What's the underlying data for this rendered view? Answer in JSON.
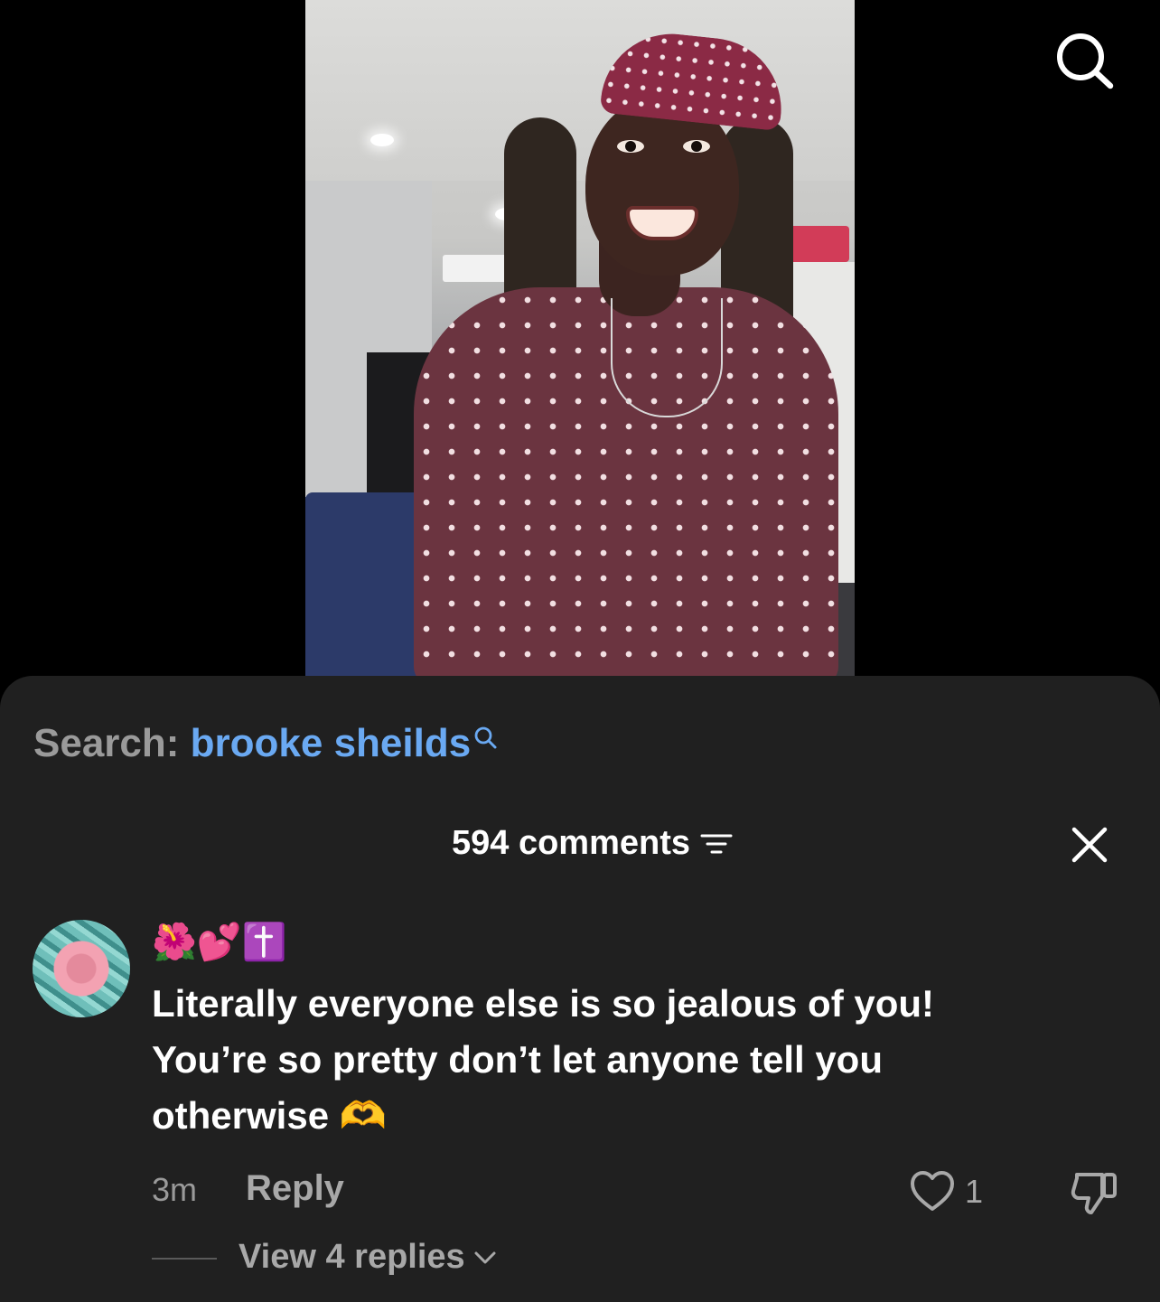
{
  "search": {
    "prefix": "Search:",
    "term": "brooke sheilds"
  },
  "comments_header": {
    "count_label": "594 comments"
  },
  "comment": {
    "username": "🌺💕✝️",
    "text": "Literally everyone else is so jealous of you! You’re so pretty don’t let anyone tell you otherwise 🫶",
    "time": "3m",
    "reply_label": "Reply",
    "like_count": "1",
    "view_replies_label": "View 4 replies"
  },
  "colors": {
    "sheet_bg": "#202020",
    "search_term": "#6aa9f2",
    "muted_text": "#9a9a9a"
  },
  "icons": [
    "search-icon",
    "filter-icon",
    "close-icon",
    "heart-icon",
    "thumbs-down-icon",
    "chevron-down-icon"
  ]
}
